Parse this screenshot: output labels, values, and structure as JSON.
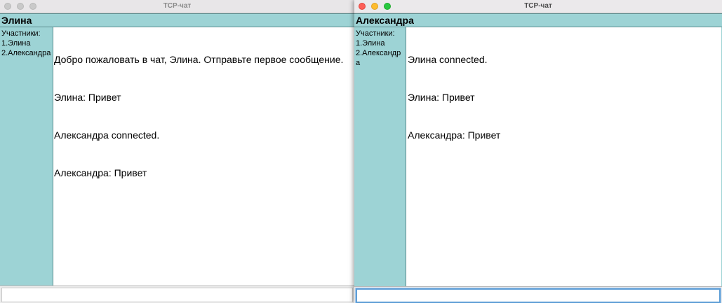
{
  "left_window": {
    "title": "TCP-чат",
    "user": "Элина",
    "participants_label": "Участники:",
    "participants": [
      "1.Элина",
      "2.Александра"
    ],
    "messages": [
      "Добро пожаловать в чат, Элина. Отправьте первое сообщение.",
      "Элина: Привет",
      "Александра connected.",
      "Александра: Привет"
    ],
    "input_value": ""
  },
  "right_window": {
    "title": "TCP-чат",
    "user": "Александра",
    "participants_label": "Участники:",
    "participants": [
      "1.Элина",
      "2.Александра"
    ],
    "messages": [
      "Элина connected.",
      "Элина: Привет",
      "Александра: Привет"
    ],
    "input_value": ""
  },
  "colors": {
    "panel": "#9dd3d5",
    "focus_ring": "#5e9ed6",
    "traffic_close": "#fe5f57",
    "traffic_minimize": "#febc2e",
    "traffic_maximize": "#28c840"
  }
}
